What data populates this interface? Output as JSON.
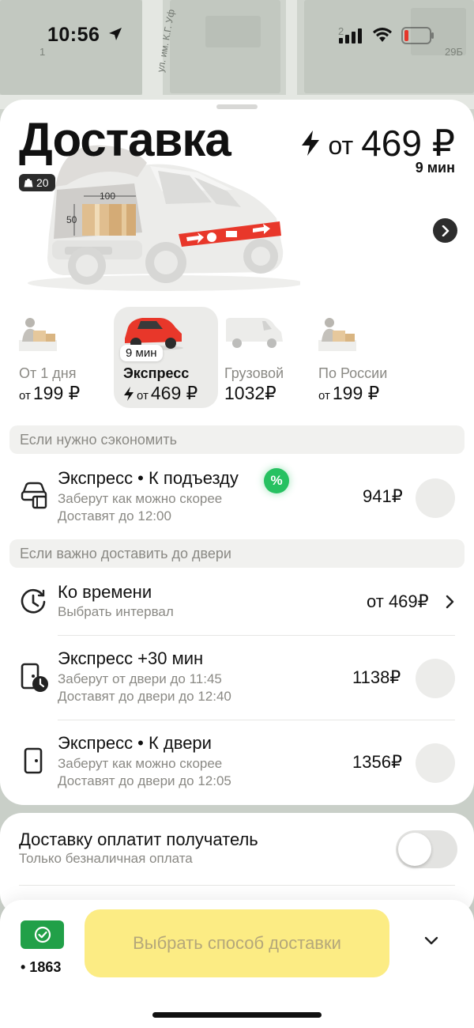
{
  "status_bar": {
    "time": "10:56"
  },
  "map": {
    "street": "ул. им. К.Г. Уф",
    "house_1": "1",
    "house_2": "2",
    "house_3": "29Б"
  },
  "hero": {
    "title": "Доставка",
    "price_prefix": "от",
    "price": "469 ₽",
    "eta": "9 мин",
    "weight": "20",
    "dim_width": "100",
    "dim_height": "50"
  },
  "tariffs": [
    {
      "name": "От 1 дня",
      "price_prefix": "от",
      "price": "199 ₽",
      "active": false
    },
    {
      "name": "Экспресс",
      "price_prefix": "от",
      "price": "469 ₽",
      "eta": "9 мин",
      "active": true
    },
    {
      "name": "Грузовой",
      "price": "1032₽",
      "active": false
    },
    {
      "name": "По России",
      "price_prefix": "от",
      "price": "199 ₽",
      "active": false
    }
  ],
  "save_group": {
    "header": "Если нужно сэкономить",
    "option": {
      "title": "Экспресс • К подъезду",
      "badge": "%",
      "line1": "Заберут как можно скорее",
      "line2": "Доставят до 12:00",
      "price": "941₽"
    }
  },
  "door_group": {
    "header": "Если важно доставить до двери",
    "options": [
      {
        "title": "Ко времени",
        "line1": "Выбрать интервал",
        "price": "от 469₽"
      },
      {
        "title": "Экспресс +30 мин",
        "line1": "Заберут от двери до 11:45",
        "line2": "Доставят до двери до 12:40",
        "price": "1138₽"
      },
      {
        "title": "Экспресс • К двери",
        "line1": "Заберут как можно скорее",
        "line2": "Доставят до двери до 12:05",
        "price": "1356₽"
      }
    ]
  },
  "recipient": {
    "title": "Доставку оплатит получатель",
    "subtitle": "Только безналичная оплата",
    "enabled": false
  },
  "bottom": {
    "card_digits": "• 1863",
    "button_label": "Выбрать способ доставки"
  },
  "colors": {
    "accent_yellow": "#fcec84",
    "discount_green": "#27c161",
    "card_green": "#21a048",
    "brand_red": "#e8372a"
  }
}
